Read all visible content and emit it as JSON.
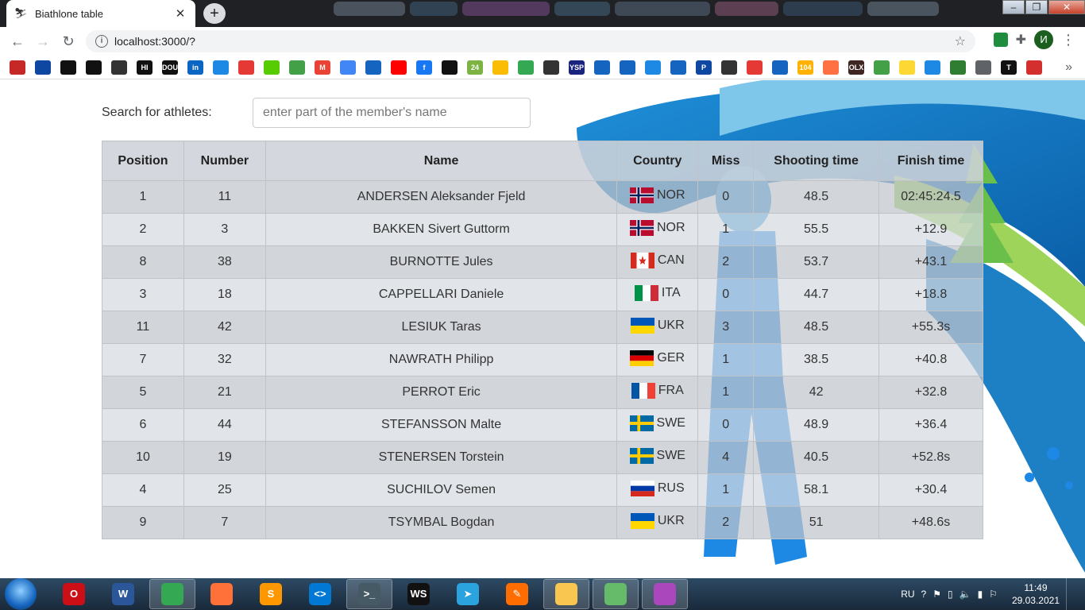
{
  "browser": {
    "tab_title": "Biathlone table",
    "tab_close": "✕",
    "new_tab": "+",
    "url": "localhost:3000/?",
    "profile_initial": "И",
    "bookmarks": [
      {
        "icon": "target-icon",
        "color": "#c62828"
      },
      {
        "icon": "react-icon",
        "color": "#0d47a1"
      },
      {
        "icon": "github-icon",
        "color": "#111111"
      },
      {
        "icon": "codepen-icon",
        "color": "#111111"
      },
      {
        "icon": "cube-icon",
        "color": "#333333"
      },
      {
        "icon": "hackernoon-icon",
        "color": "#111111",
        "text": "HI"
      },
      {
        "icon": "dou-icon",
        "color": "#111111",
        "text": "DOU"
      },
      {
        "icon": "linkedin-icon",
        "color": "#0a66c2",
        "text": "in"
      },
      {
        "icon": "shield-icon",
        "color": "#1e88e5"
      },
      {
        "icon": "spiral-icon",
        "color": "#e53935"
      },
      {
        "icon": "owl-icon",
        "color": "#58cc02"
      },
      {
        "icon": "flower-icon",
        "color": "#43a047"
      },
      {
        "icon": "gmail-icon",
        "color": "#ea4335",
        "text": "M"
      },
      {
        "icon": "translate-icon",
        "color": "#4285f4"
      },
      {
        "icon": "mail-icon",
        "color": "#1565c0"
      },
      {
        "icon": "youtube-icon",
        "color": "#ff0000"
      },
      {
        "icon": "facebook-icon",
        "color": "#1877f2",
        "text": "f"
      },
      {
        "icon": "app-icon",
        "color": "#111111"
      },
      {
        "icon": "news24-icon",
        "color": "#7cb342",
        "text": "24"
      },
      {
        "icon": "drive-icon",
        "color": "#fbbc04"
      },
      {
        "icon": "maps-icon",
        "color": "#34a853"
      },
      {
        "icon": "speed-icon",
        "color": "#333333"
      },
      {
        "icon": "ysp-icon",
        "color": "#1a237e",
        "text": "YSP"
      },
      {
        "icon": "globe-icon",
        "color": "#1565c0"
      },
      {
        "icon": "globe-icon",
        "color": "#1565c0"
      },
      {
        "icon": "drop-icon",
        "color": "#1e88e5"
      },
      {
        "icon": "globe-icon",
        "color": "#1565c0"
      },
      {
        "icon": "p-icon",
        "color": "#0d47a1",
        "text": "P"
      },
      {
        "icon": "snowflake-icon",
        "color": "#333333"
      },
      {
        "icon": "dice-icon",
        "color": "#e53935"
      },
      {
        "icon": "globe-icon",
        "color": "#1565c0"
      },
      {
        "icon": "badge-icon",
        "color": "#ffb300",
        "text": "104"
      },
      {
        "icon": "check-icon",
        "color": "#ff7043"
      },
      {
        "icon": "olx-icon",
        "color": "#3e2723",
        "text": "OLX"
      },
      {
        "icon": "star-icon",
        "color": "#43a047"
      },
      {
        "icon": "puzzle-icon",
        "color": "#fdd835"
      },
      {
        "icon": "home-icon",
        "color": "#1e88e5"
      },
      {
        "icon": "circle-icon",
        "color": "#2e7d32"
      },
      {
        "icon": "doc-icon",
        "color": "#5f6368"
      },
      {
        "icon": "t-icon",
        "color": "#111111",
        "text": "T"
      },
      {
        "icon": "hand-icon",
        "color": "#d32f2f"
      }
    ]
  },
  "search": {
    "label": "Search for athletes:",
    "placeholder": "enter part of the member's name"
  },
  "table": {
    "headers": [
      "Position",
      "Number",
      "Name",
      "Country",
      "Miss",
      "Shooting time",
      "Finish time"
    ],
    "rows": [
      {
        "position": "1",
        "number": "11",
        "name": "ANDERSEN Aleksander Fjeld",
        "country": "NOR",
        "miss": "0",
        "shooting": "48.5",
        "finish": "02:45:24.5"
      },
      {
        "position": "2",
        "number": "3",
        "name": "BAKKEN Sivert Guttorm",
        "country": "NOR",
        "miss": "1",
        "shooting": "55.5",
        "finish": "+12.9"
      },
      {
        "position": "8",
        "number": "38",
        "name": "BURNOTTE Jules",
        "country": "CAN",
        "miss": "2",
        "shooting": "53.7",
        "finish": "+43.1"
      },
      {
        "position": "3",
        "number": "18",
        "name": "CAPPELLARI Daniele",
        "country": "ITA",
        "miss": "0",
        "shooting": "44.7",
        "finish": "+18.8"
      },
      {
        "position": "11",
        "number": "42",
        "name": "LESIUK Taras",
        "country": "UKR",
        "miss": "3",
        "shooting": "48.5",
        "finish": "+55.3s"
      },
      {
        "position": "7",
        "number": "32",
        "name": "NAWRATH Philipp",
        "country": "GER",
        "miss": "1",
        "shooting": "38.5",
        "finish": "+40.8"
      },
      {
        "position": "5",
        "number": "21",
        "name": "PERROT Eric",
        "country": "FRA",
        "miss": "1",
        "shooting": "42",
        "finish": "+32.8"
      },
      {
        "position": "6",
        "number": "44",
        "name": "STEFANSSON Malte",
        "country": "SWE",
        "miss": "0",
        "shooting": "48.9",
        "finish": "+36.4"
      },
      {
        "position": "10",
        "number": "19",
        "name": "STENERSEN Torstein",
        "country": "SWE",
        "miss": "4",
        "shooting": "40.5",
        "finish": "+52.8s"
      },
      {
        "position": "4",
        "number": "25",
        "name": "SUCHILOV Semen",
        "country": "RUS",
        "miss": "1",
        "shooting": "58.1",
        "finish": "+30.4"
      },
      {
        "position": "9",
        "number": "7",
        "name": "TSYMBAL Bogdan",
        "country": "UKR",
        "miss": "2",
        "shooting": "51",
        "finish": "+48.6s"
      }
    ]
  },
  "taskbar": {
    "apps": [
      {
        "icon": "opera-icon",
        "color": "#cc0f16",
        "text": "O"
      },
      {
        "icon": "word-icon",
        "color": "#2b579a",
        "text": "W"
      },
      {
        "icon": "chrome-icon",
        "color": "#34a853",
        "text": "",
        "active": true
      },
      {
        "icon": "firefox-icon",
        "color": "#ff7139",
        "text": ""
      },
      {
        "icon": "sublime-icon",
        "color": "#ff9800",
        "text": "S"
      },
      {
        "icon": "vscode-icon",
        "color": "#0078d4",
        "text": "<>"
      },
      {
        "icon": "terminal-icon",
        "color": "#455a64",
        "text": ">_",
        "active": true
      },
      {
        "icon": "webstorm-icon",
        "color": "#111111",
        "text": "WS"
      },
      {
        "icon": "telegram-icon",
        "color": "#2aa3df",
        "text": "➤"
      },
      {
        "icon": "pen-icon",
        "color": "#ff6d00",
        "text": "✎"
      },
      {
        "icon": "folder-icon",
        "color": "#f9c74f",
        "text": "",
        "active": true
      },
      {
        "icon": "tiles-icon",
        "color": "#66bb6a",
        "text": "",
        "active": true
      },
      {
        "icon": "paint-icon",
        "color": "#ab47bc",
        "text": "",
        "active": true
      }
    ],
    "lang": "RU",
    "time": "11:49",
    "date": "29.03.2021"
  }
}
